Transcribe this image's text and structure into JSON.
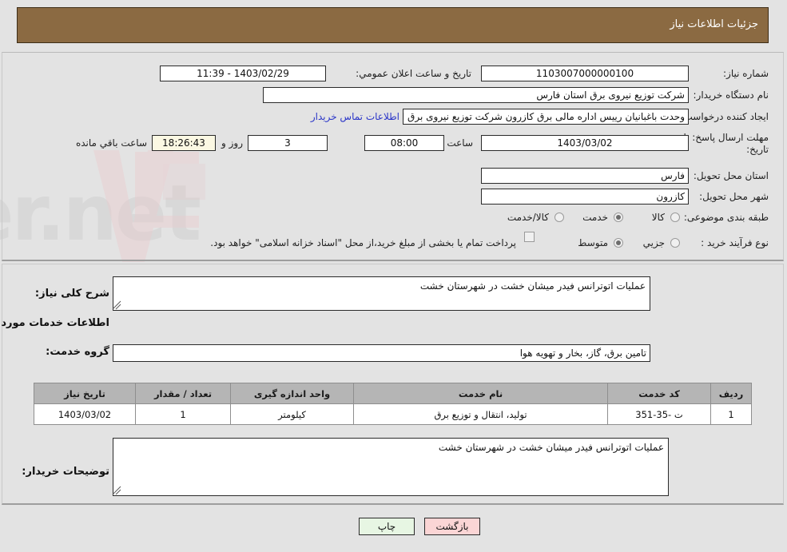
{
  "header": {
    "title": "جزئیات اطلاعات نیاز",
    "bg_color": "#8b6a42",
    "text_color": "#ffffff"
  },
  "top_form": {
    "need_number": {
      "label": "شماره نیاز:",
      "value": "1103007000000100"
    },
    "public_announce": {
      "label": "تاریخ و ساعت اعلان عمومي:",
      "value": "1403/02/29 - 11:39"
    },
    "buyer_org": {
      "label": "نام دستگاه خریدار:",
      "value": "شرکت توزیع نیروی برق استان فارس"
    },
    "request_creator": {
      "label": "ایجاد کننده درخواست:",
      "value": "وحدت باغبانیان رییس اداره مالی برق کازرون شرکت توزیع نیروی برق استان فارس",
      "contact_link": "اطلاعات تماس خریدار",
      "link_color": "#2b36c8"
    },
    "deadline": {
      "label": "مهلت ارسال پاسخ: تا تاریخ:",
      "date": "1403/03/02",
      "time_label": "ساعت",
      "time": "08:00",
      "days": "3",
      "days_label": "روز و",
      "countdown": "18:26:43",
      "countdown_suffix": "ساعت باقي مانده",
      "countdown_bg": "#fbf8e3"
    },
    "province": {
      "label": "استان محل تحویل:",
      "value": "فارس"
    },
    "city": {
      "label": "شهر محل تحویل:",
      "value": "کازرون"
    },
    "category": {
      "label": "طبقه بندی موضوعی:",
      "options": [
        "کالا",
        "خدمت",
        "کالا/خدمت"
      ],
      "selected_index": 1
    },
    "purchase_type": {
      "label": "نوع فرآیند خرید :",
      "options": [
        "جزیي",
        "متوسط"
      ],
      "selected_index": 1,
      "checkbox_label": "پرداخت تمام یا بخشی از مبلغ خرید،از محل \"اسناد خزانه اسلامی\" خواهد بود.",
      "checkbox_checked": false
    }
  },
  "bottom_form": {
    "general_desc": {
      "label": "شرح کلی نیاز:",
      "value": "عملیات اتوترانس فیدر میشان خشت در شهرستان خشت"
    },
    "services_heading": "اطلاعات خدمات مورد نیاز",
    "service_group": {
      "label": "گروه خدمت:",
      "value": "تامین برق، گاز، بخار و تهویه هوا"
    },
    "buyer_notes": {
      "label": "توضیحات خریدار:",
      "value": "عملیات اتوترانس فیدر میشان خشت در شهرستان خشت"
    }
  },
  "service_table": {
    "columns": [
      "ردیف",
      "کد خدمت",
      "نام خدمت",
      "واحد اندازه گیری",
      "تعداد / مقدار",
      "تاریخ نیاز"
    ],
    "rows": [
      {
        "index": "1",
        "code": "ت -35-351",
        "name": "تولید، انتقال و توزیع برق",
        "unit": "کیلومتر",
        "quantity": "1",
        "need_date": "1403/03/02"
      }
    ]
  },
  "footer": {
    "print_label": "چاپ",
    "back_label": "بازگشت"
  },
  "watermark": {
    "text": "AriaTender.net"
  }
}
